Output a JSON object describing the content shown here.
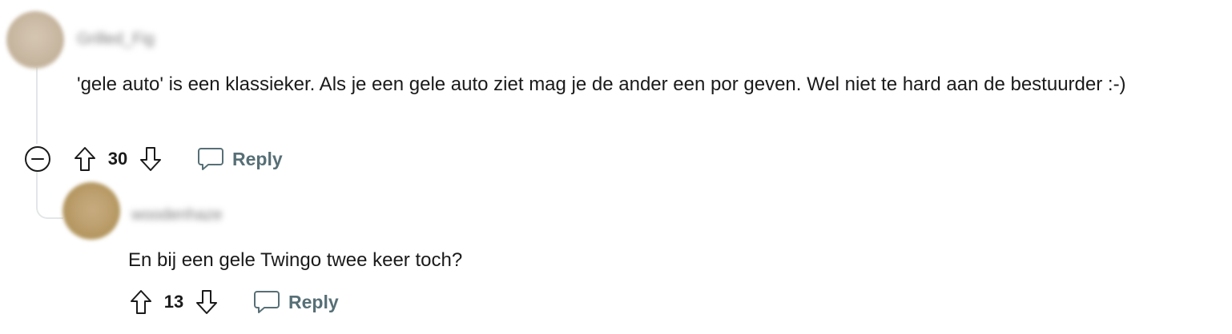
{
  "parent_comment": {
    "username": "Grilled_Fig",
    "body": "'gele auto' is een klassieker. Als je een gele auto ziet mag je de ander een por geven. Wel niet te hard aan de bestuurder :-)",
    "score": "30",
    "reply_label": "Reply",
    "icons": {
      "collapse": "collapse-minus-icon",
      "upvote": "arrow-up-icon",
      "downvote": "arrow-down-icon",
      "reply": "speech-bubble-icon"
    }
  },
  "child_comment": {
    "username": "woodenhaze",
    "body": "En bij een gele Twingo twee keer toch?",
    "score": "13",
    "reply_label": "Reply"
  },
  "colors": {
    "text": "#1a1a1b",
    "muted": "#576f76",
    "thread_line": "#e3e6e8"
  }
}
